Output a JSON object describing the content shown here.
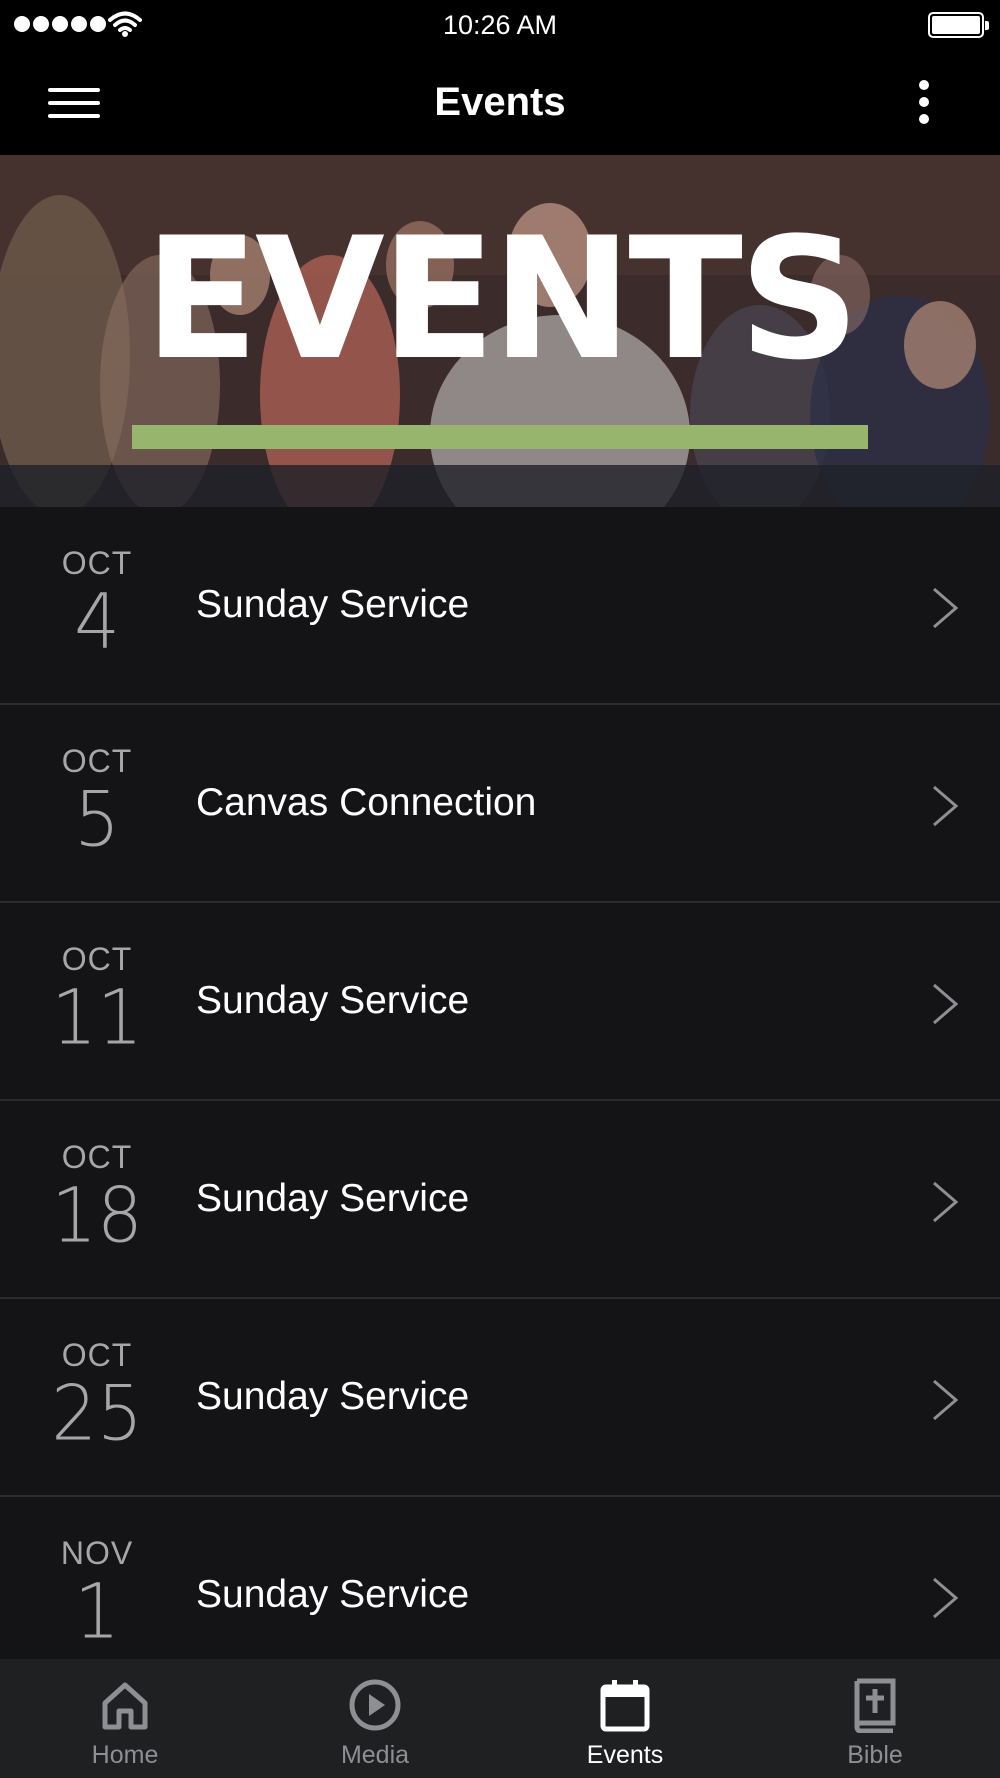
{
  "status_bar": {
    "time": "10:26 AM"
  },
  "nav": {
    "title": "Events"
  },
  "banner": {
    "title": "EVENTS",
    "underline_color": "#97b56d"
  },
  "events": [
    {
      "month": "OCT",
      "day": "4",
      "title": "Sunday Service"
    },
    {
      "month": "OCT",
      "day": "5",
      "title": "Canvas Connection"
    },
    {
      "month": "OCT",
      "day": "11",
      "title": "Sunday Service"
    },
    {
      "month": "OCT",
      "day": "18",
      "title": "Sunday Service"
    },
    {
      "month": "OCT",
      "day": "25",
      "title": "Sunday Service"
    },
    {
      "month": "NOV",
      "day": "1",
      "title": "Sunday Service"
    }
  ],
  "tab_bar": {
    "tabs": [
      {
        "label": "Home",
        "icon": "home-icon",
        "active": false
      },
      {
        "label": "Media",
        "icon": "play-circle-icon",
        "active": false
      },
      {
        "label": "Events",
        "icon": "calendar-icon",
        "active": true
      },
      {
        "label": "Bible",
        "icon": "bible-icon",
        "active": false
      }
    ]
  }
}
